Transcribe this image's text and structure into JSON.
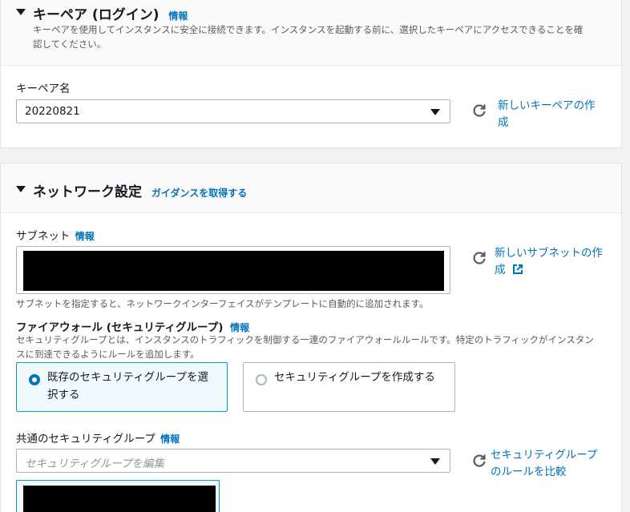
{
  "keypair": {
    "title": "キーペア (ログイン)",
    "info": "情報",
    "description_line1": "キーペアを使用してインスタンスに安全に接続できます。インスタンスを起動する前に、選択したキーペアにアクセスできることを確",
    "description_line2": "認してください。",
    "field_label": "キーペア名",
    "selected_value": "20220821",
    "create_link_line1": "新しいキーペアの作",
    "create_link_line2": "成"
  },
  "network": {
    "title": "ネットワーク設定",
    "guidance_link": "ガイダンスを取得する",
    "subnet_label": "サブネット",
    "subnet_info": "情報",
    "create_subnet_line1": "新しいサブネットの作",
    "create_subnet_line2": "成",
    "subnet_help": "サブネットを指定すると、ネットワークインターフェイスがテンプレートに自動的に追加されます。",
    "firewall_label": "ファイアウォール (セキュリティグループ)",
    "firewall_info": "情報",
    "firewall_desc_line1": "セキュリティグループとは、インスタンスのトラフィックを制御する一連のファイアウォールルールです。特定のトラフィックがインスタン",
    "firewall_desc_line2": "スに到達できるようにルールを追加します。",
    "option_existing_line1": "既存のセキュリティグループを選",
    "option_existing_line2": "択する",
    "option_create": "セキュリティグループを作成する",
    "common_sg_label": "共通のセキュリティグループ",
    "common_sg_info": "情報",
    "sg_placeholder": "セキュリティグループを編集",
    "compare_link_line1": "セキュリティグループ",
    "compare_link_line2": "のルールを比較"
  },
  "colors": {
    "link": "#0073bb",
    "selected_border": "#00a1c9"
  }
}
